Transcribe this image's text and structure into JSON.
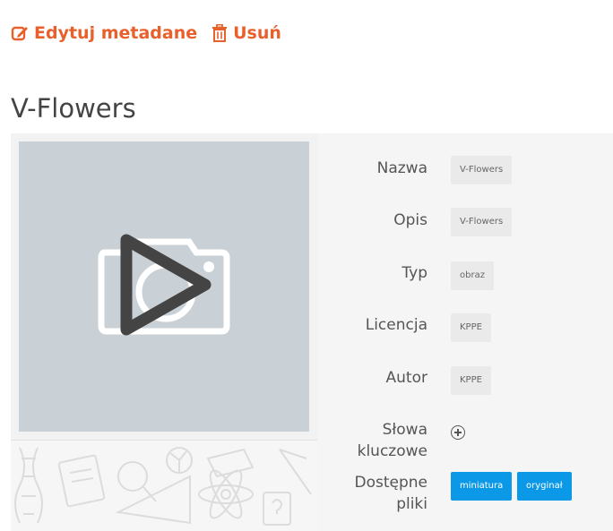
{
  "actions": {
    "edit_label": "Edytuj metadane",
    "delete_label": "Usuń"
  },
  "page": {
    "title": "V-Flowers"
  },
  "preview": {
    "icon": "camera-icon",
    "overlay_icon": "play-icon"
  },
  "metadata": {
    "name_label": "Nazwa",
    "name_value": "V-Flowers",
    "description_label": "Opis",
    "description_value": "V-Flowers",
    "type_label": "Typ",
    "type_value": "obraz",
    "license_label": "Licencja",
    "license_value": "KPPE",
    "author_label": "Autor",
    "author_value": "KPPE",
    "keywords_label_line1": "Słowa",
    "keywords_label_line2": "kluczowe",
    "files_label_line1": "Dostępne",
    "files_label_line2": "pliki",
    "files": [
      "miniatura",
      "oryginał"
    ]
  },
  "colors": {
    "accent": "#e8602c",
    "button": "#0b98e6",
    "preview_bg": "#c9d1d7"
  }
}
